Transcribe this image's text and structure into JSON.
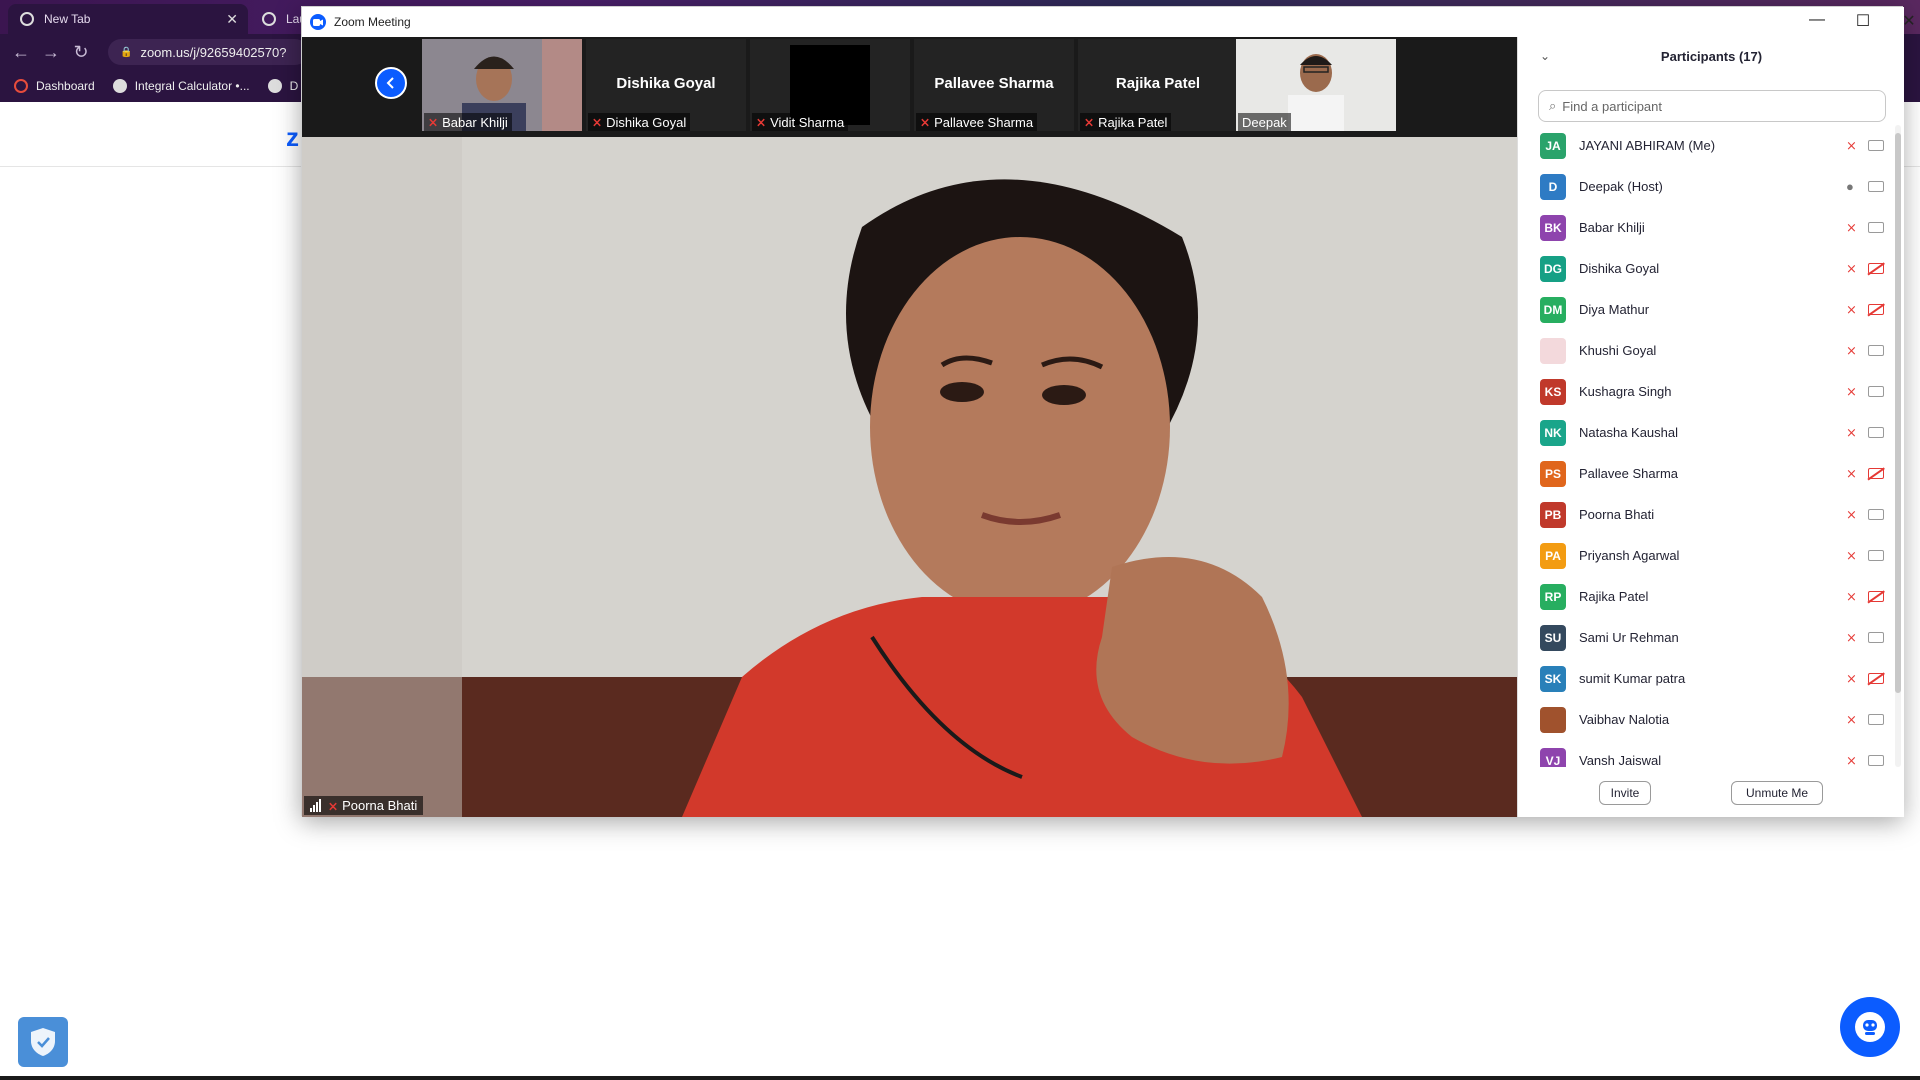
{
  "browser": {
    "tabs": [
      {
        "title": "New Tab"
      },
      {
        "title": "Lau"
      }
    ],
    "url": "zoom.us/j/92659402570?",
    "bookmarks": [
      {
        "label": "Dashboard"
      },
      {
        "label": "Integral Calculator •..."
      },
      {
        "label": "D"
      }
    ]
  },
  "page": {
    "logo_text": "z"
  },
  "zoom": {
    "window_title": "Zoom Meeting",
    "strip": [
      {
        "name_overlay": "",
        "label": "Babar Khilji",
        "muted": true,
        "has_video": true
      },
      {
        "name_overlay": "Dishika Goyal",
        "label": "Dishika Goyal",
        "muted": true,
        "has_video": false
      },
      {
        "name_overlay": "",
        "label": "Vidit Sharma",
        "muted": true,
        "has_video": false
      },
      {
        "name_overlay": "Pallavee Sharma",
        "label": "Pallavee Sharma",
        "muted": true,
        "has_video": false
      },
      {
        "name_overlay": "Rajika Patel",
        "label": "Rajika Patel",
        "muted": true,
        "has_video": false
      },
      {
        "name_overlay": "",
        "label": "Deepak",
        "muted": false,
        "has_video": true
      }
    ],
    "main_speaker": {
      "label": "Poorna Bhati",
      "muted": true
    }
  },
  "participants": {
    "title": "Participants (17)",
    "search_placeholder": "Find a participant",
    "list": [
      {
        "initials": "JA",
        "name": "JAYANI ABHIRAM (Me)",
        "color": "#2aa36b",
        "mic": "muted",
        "cam": "on"
      },
      {
        "initials": "D",
        "name": "Deepak (Host)",
        "color": "#2e7bc4",
        "mic": "on",
        "cam": "on"
      },
      {
        "initials": "BK",
        "name": "Babar Khilji",
        "color": "#8e44ad",
        "mic": "muted",
        "cam": "on"
      },
      {
        "initials": "DG",
        "name": "Dishika Goyal",
        "color": "#16a085",
        "mic": "muted",
        "cam": "off"
      },
      {
        "initials": "DM",
        "name": "Diya Mathur",
        "color": "#27ae60",
        "mic": "muted",
        "cam": "off"
      },
      {
        "initials": "",
        "name": "Khushi Goyal",
        "color": "#f3d9dc",
        "mic": "muted",
        "cam": "on"
      },
      {
        "initials": "KS",
        "name": "Kushagra Singh",
        "color": "#c0392b",
        "mic": "muted",
        "cam": "on"
      },
      {
        "initials": "NK",
        "name": "Natasha Kaushal",
        "color": "#1aa58a",
        "mic": "muted",
        "cam": "on"
      },
      {
        "initials": "PS",
        "name": "Pallavee Sharma",
        "color": "#e0661c",
        "mic": "muted",
        "cam": "off"
      },
      {
        "initials": "PB",
        "name": "Poorna Bhati",
        "color": "#c0392b",
        "mic": "muted",
        "cam": "on"
      },
      {
        "initials": "PA",
        "name": "Priyansh Agarwal",
        "color": "#f39c12",
        "mic": "muted",
        "cam": "on"
      },
      {
        "initials": "RP",
        "name": "Rajika Patel",
        "color": "#27ae60",
        "mic": "muted",
        "cam": "off"
      },
      {
        "initials": "SU",
        "name": "Sami Ur Rehman",
        "color": "#34495e",
        "mic": "muted",
        "cam": "on"
      },
      {
        "initials": "SK",
        "name": "sumit Kumar patra",
        "color": "#2980b9",
        "mic": "muted",
        "cam": "off"
      },
      {
        "initials": "",
        "name": "Vaibhav Nalotia",
        "color": "#a0522d",
        "mic": "muted",
        "cam": "on"
      },
      {
        "initials": "VJ",
        "name": "Vansh Jaiswal",
        "color": "#8e44ad",
        "mic": "muted",
        "cam": "on"
      }
    ],
    "invite_label": "Invite",
    "unmute_label": "Unmute Me"
  }
}
